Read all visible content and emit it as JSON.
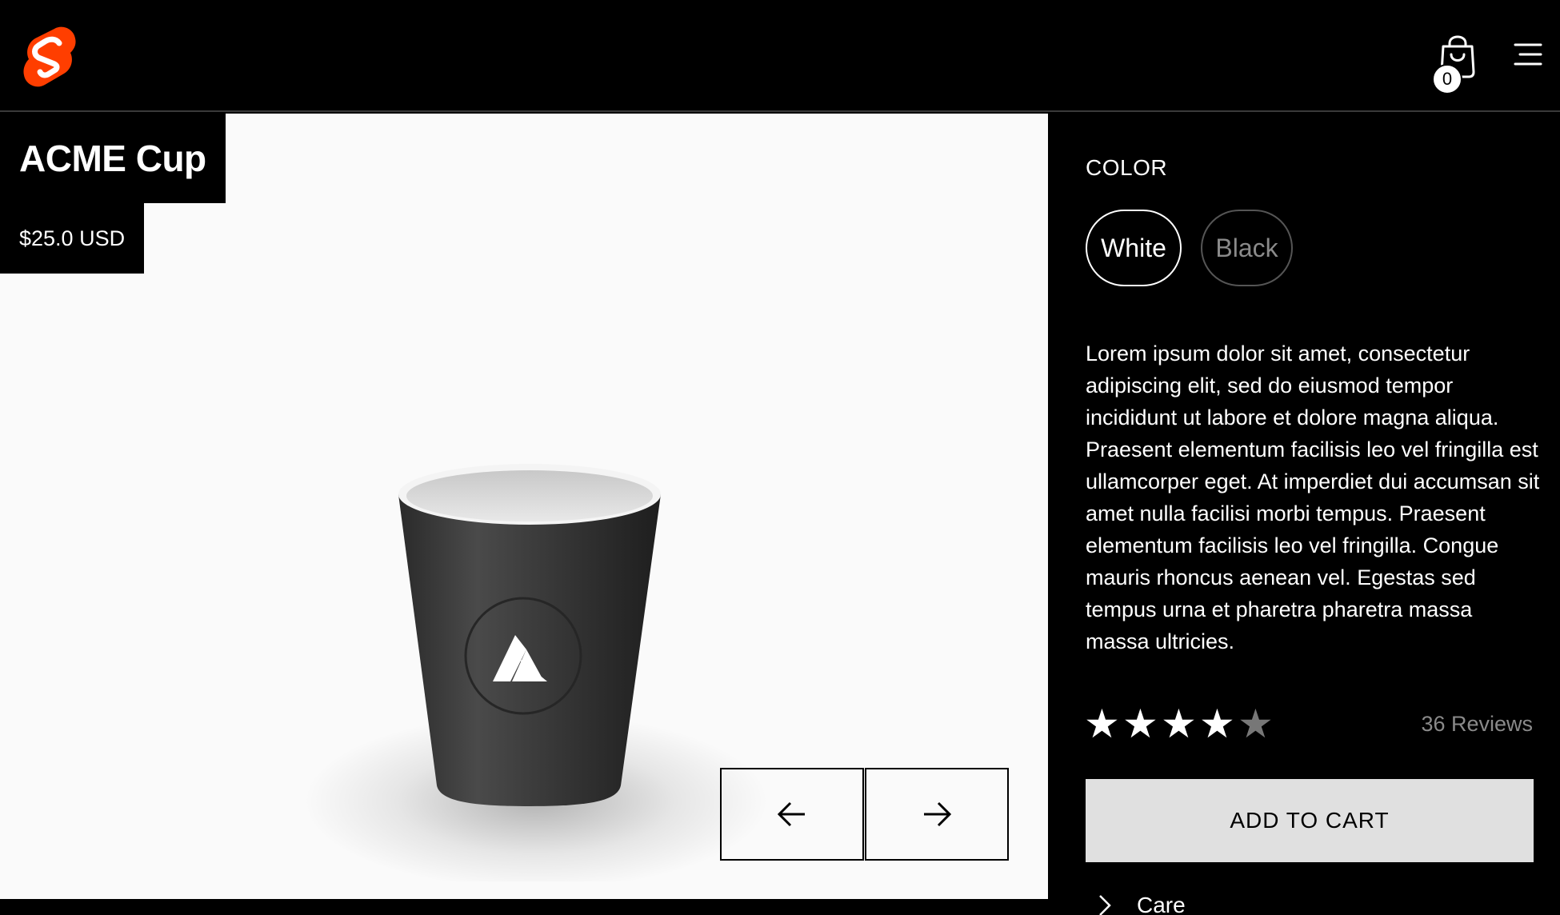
{
  "header": {
    "logo_icon": "svelte-logo",
    "cart_icon": "shopping-bag-icon",
    "cart_count": "0",
    "menu_icon": "hamburger-menu-icon"
  },
  "product": {
    "title": "ACME Cup",
    "price": "$25.0 USD",
    "image": "black-cup-with-acme-logo"
  },
  "gallery": {
    "prev_icon": "arrow-left-icon",
    "next_icon": "arrow-right-icon"
  },
  "options": {
    "color_label": "COLOR",
    "colors": [
      {
        "label": "White",
        "selected": true
      },
      {
        "label": "Black",
        "selected": false
      }
    ]
  },
  "description": "Lorem ipsum dolor sit amet, consectetur adipiscing elit, sed do eiusmod tempor incididunt ut labore et dolore magna aliqua. Praesent elementum facilisis leo vel fringilla est ullamcorper eget. At imperdiet dui accumsan sit amet nulla facilisi morbi tempus. Praesent elementum facilisis leo vel fringilla. Congue mauris rhoncus aenean vel. Egestas sed tempus urna et pharetra pharetra massa massa ultricies.",
  "rating": {
    "stars_filled": 4,
    "stars_total": 5,
    "reviews_label": "36 Reviews"
  },
  "cart": {
    "add_label": "ADD TO CART"
  },
  "accordion": {
    "care_label": "Care"
  },
  "colors": {
    "header_bg": "#000000",
    "gallery_bg": "#fafafa",
    "button_bg": "#e0e0e0",
    "logo_orange": "#ff3e00",
    "muted_text": "#8a8a8a"
  }
}
